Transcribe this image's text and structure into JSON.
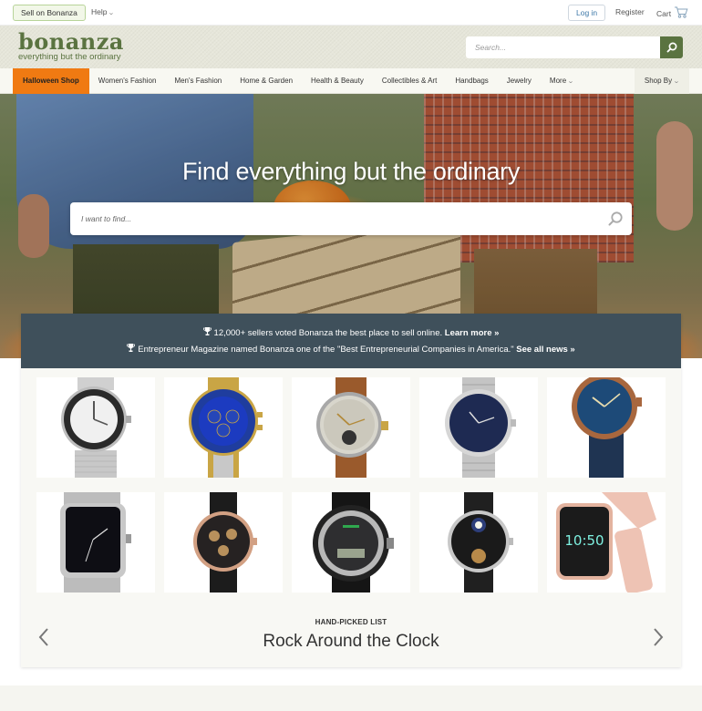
{
  "topbar": {
    "sell_label": "Sell on Bonanza",
    "help_label": "Help",
    "login_label": "Log in",
    "register_label": "Register",
    "cart_label": "Cart"
  },
  "header": {
    "logo_text": "bonanza",
    "logo_tagline": "everything but the ordinary",
    "search_placeholder": "Search...",
    "brand_color": "#5a7340"
  },
  "nav": {
    "items": [
      {
        "label": "Halloween Shop",
        "active": true
      },
      {
        "label": "Women's Fashion"
      },
      {
        "label": "Men's Fashion"
      },
      {
        "label": "Home & Garden"
      },
      {
        "label": "Health & Beauty"
      },
      {
        "label": "Collectibles & Art"
      },
      {
        "label": "Handbags"
      },
      {
        "label": "Jewelry"
      },
      {
        "label": "More"
      }
    ],
    "shop_by_label": "Shop By",
    "active_color": "#f07a12"
  },
  "hero": {
    "title": "Find everything but the ordinary",
    "search_placeholder": "I want to find..."
  },
  "news": {
    "line1_text": "12,000+ sellers voted Bonanza the best place to sell online.",
    "line1_link": "Learn more »",
    "line2_text": "Entrepreneur Magazine named Bonanza one of the \"Best Entrepreneurial Companies in America.\"",
    "line2_link": "See all news »",
    "bg_color": "#3f505b"
  },
  "products": [
    {
      "icon": "watch-white-dial-mesh-icon"
    },
    {
      "icon": "watch-blue-chronograph-icon"
    },
    {
      "icon": "watch-silver-dial-brown-strap-icon"
    },
    {
      "icon": "watch-navy-dial-steel-icon"
    },
    {
      "icon": "watch-bronze-blue-strap-icon"
    },
    {
      "icon": "watch-square-black-mesh-icon"
    },
    {
      "icon": "watch-rose-gold-skeleton-icon"
    },
    {
      "icon": "watch-black-digital-sport-icon"
    },
    {
      "icon": "watch-moonphase-leather-icon"
    },
    {
      "icon": "smartwatch-pink-icon"
    }
  ],
  "smartwatch_time": "10:50",
  "list": {
    "label": "HAND-PICKED LIST",
    "title": "Rock Around the Clock"
  }
}
